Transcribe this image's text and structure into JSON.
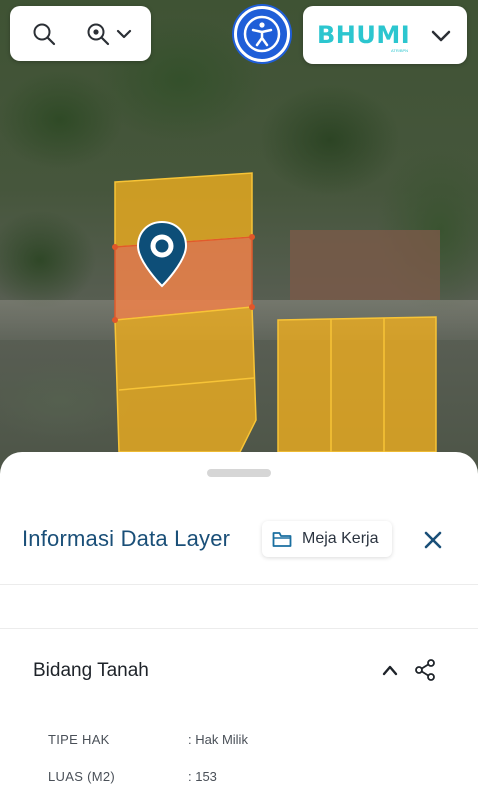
{
  "toolbar": {
    "search_icon": "search-icon",
    "zoom_icon": "location-search-icon",
    "dropdown_icon": "chevron-down-icon",
    "accessibility_icon": "accessibility-icon",
    "brand": "BHUMI",
    "brand_sub": "ATR/BPN",
    "brand_dropdown_icon": "chevron-down-icon"
  },
  "map": {
    "marker_icon": "map-pin-icon",
    "parcel_color": "#f2b01e",
    "selected_parcel_color": "#f0824a",
    "marker_color": "#0d4e78"
  },
  "panel": {
    "title": "Informasi Data Layer",
    "meja_label": "Meja Kerja",
    "folder_icon": "folder-icon",
    "close_icon": "close-icon",
    "section_title": "Bidang Tanah",
    "collapse_icon": "chevron-up-icon",
    "share_icon": "share-icon",
    "rows": [
      {
        "key": "TIPE HAK",
        "value": ": Hak Milik"
      },
      {
        "key": "LUAS (M2)",
        "value": ": 153"
      }
    ]
  },
  "colors": {
    "title": "#1a4f78",
    "accent": "#1f5ed8",
    "brand": "#2cc6cf"
  }
}
